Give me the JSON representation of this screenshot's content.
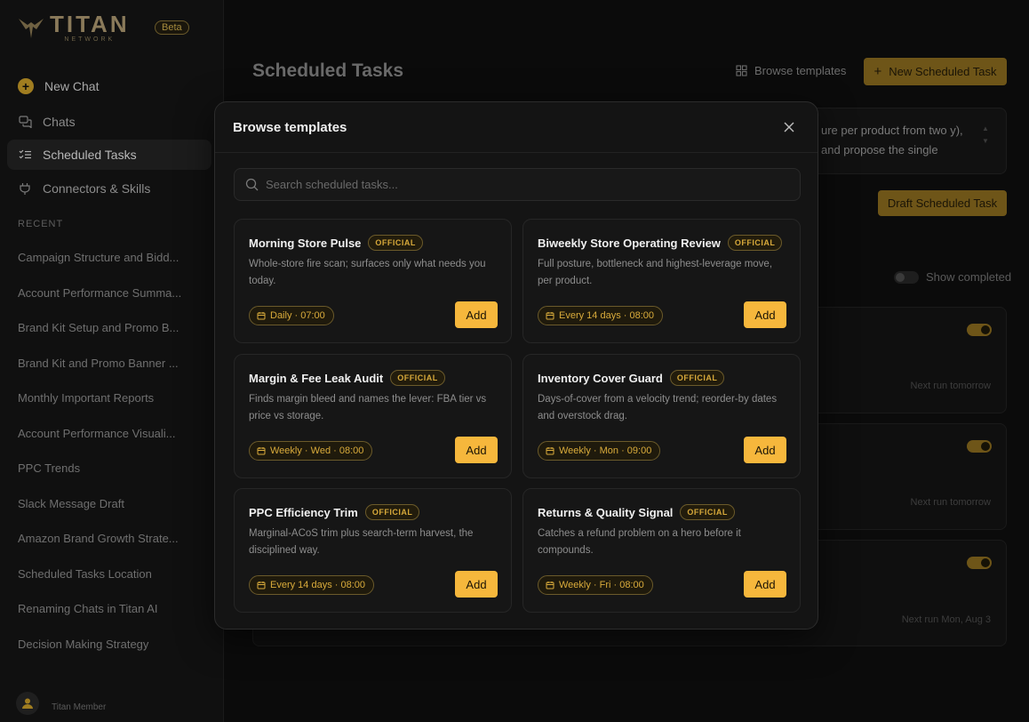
{
  "sidebar": {
    "logo_title": "TITAN",
    "logo_sub": "NETWORK",
    "beta": "Beta",
    "nav": {
      "new_chat": "New Chat",
      "chats": "Chats",
      "scheduled_tasks": "Scheduled Tasks",
      "connectors": "Connectors & Skills"
    },
    "recent_label": "RECENT",
    "recent": [
      "Campaign Structure and Bidd...",
      "Account Performance Summa...",
      "Brand Kit Setup and Promo B...",
      "Brand Kit and Promo Banner ...",
      "Monthly Important Reports",
      "Account Performance Visuali...",
      "PPC Trends",
      "Slack Message Draft",
      "Amazon Brand Growth Strate...",
      "Scheduled Tasks Location",
      "Renaming Chats in Titan AI",
      "Decision Making Strategy"
    ],
    "user_name": "Titan Member"
  },
  "main": {
    "title": "Scheduled Tasks",
    "browse_templates": "Browse templates",
    "new_task": "New Scheduled Task",
    "prompt_text": "ure per product from two y), and propose the single",
    "draft_button": "Draft Scheduled Task",
    "show_completed": "Show completed",
    "next_runs": [
      "Next run tomorrow",
      "Next run tomorrow",
      "Next run Mon, Aug 3"
    ]
  },
  "modal": {
    "title": "Browse templates",
    "search_placeholder": "Search scheduled tasks...",
    "official_label": "OFFICIAL",
    "add_label": "Add",
    "templates": [
      {
        "name": "Morning Store Pulse",
        "desc": "Whole-store fire scan; surfaces only what needs you today.",
        "schedule": "Daily · 07:00"
      },
      {
        "name": "Biweekly Store Operating Review",
        "desc": "Full posture, bottleneck and highest-leverage move, per product.",
        "schedule": "Every 14 days · 08:00"
      },
      {
        "name": "Margin & Fee Leak Audit",
        "desc": "Finds margin bleed and names the lever: FBA tier vs price vs storage.",
        "schedule": "Weekly · Wed · 08:00"
      },
      {
        "name": "Inventory Cover Guard",
        "desc": "Days-of-cover from a velocity trend; reorder-by dates and overstock drag.",
        "schedule": "Weekly · Mon · 09:00"
      },
      {
        "name": "PPC Efficiency Trim",
        "desc": "Marginal-ACoS trim plus search-term harvest, the disciplined way.",
        "schedule": "Every 14 days · 08:00"
      },
      {
        "name": "Returns & Quality Signal",
        "desc": "Catches a refund problem on a hero before it compounds.",
        "schedule": "Weekly · Fri · 08:00"
      }
    ]
  },
  "colors": {
    "accent": "#f6b73c",
    "accent_dim": "#6e5518",
    "official_text": "#d6a83a"
  }
}
